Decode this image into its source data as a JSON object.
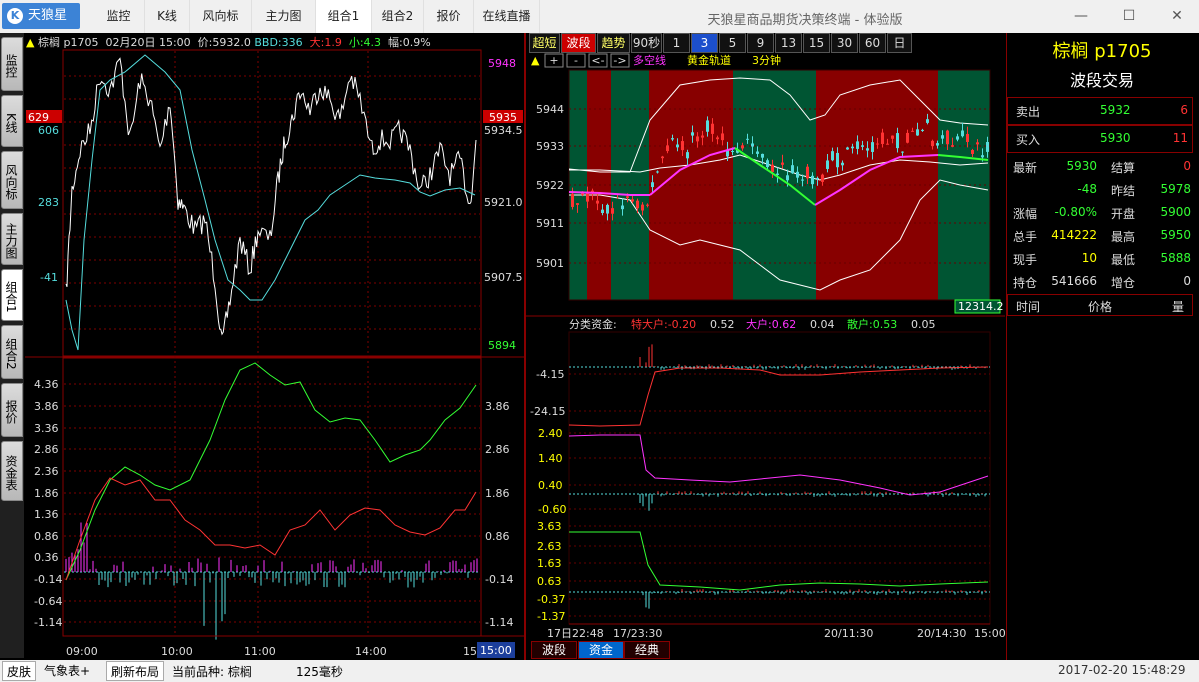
{
  "app": {
    "logo": "天狼星",
    "logo_mark": "K",
    "title": "天狼星商品期货决策终端 - 体验版"
  },
  "nav": [
    "监控",
    "K线",
    "风向标",
    "主力图",
    "组合1",
    "组合2",
    "报价",
    "在线直播"
  ],
  "nav_active": 4,
  "sidebar": [
    "监控",
    "K线",
    "风向标",
    "主力图",
    "组合1",
    "组合2",
    "报价",
    "资金表"
  ],
  "sidebar_active": 4,
  "left_panel": {
    "info": {
      "name": "棕榈",
      "code": "p1705",
      "date": "02月20日",
      "time": "15:00",
      "price": "价:5932.0",
      "bbd": "BBD:336",
      "big": "大:1.9",
      "small": "小:4.3",
      "amp": "幅:0.9%"
    },
    "price_axis_right": [
      "5948",
      "5935",
      "5934.5",
      "5921.0",
      "5907.5",
      "5894"
    ],
    "price_axis_left": [
      "629",
      "606",
      "283",
      "-41"
    ],
    "fund_axis_left": [
      "4.36",
      "3.86",
      "3.36",
      "2.86",
      "2.36",
      "1.86",
      "1.36",
      "0.86",
      "0.36",
      "-0.14",
      "-0.64",
      "-1.14"
    ],
    "fund_axis_right": [
      "3.86",
      "2.86",
      "1.86",
      "0.86",
      "-0.14",
      "-1.14"
    ],
    "time_axis": [
      "09:00",
      "10:00",
      "11:00",
      "14:00",
      "15"
    ],
    "cursor_time": "15:00"
  },
  "middle_panel": {
    "top_buttons": [
      "超短",
      "波段",
      "趋势",
      "90秒",
      "1",
      "3",
      "5",
      "9",
      "13",
      "15",
      "30",
      "60",
      "日"
    ],
    "toolbar": [
      "▲",
      "+",
      "-",
      "<-",
      "->"
    ],
    "legend": {
      "line": "多空线",
      "gold": "黄金轨道",
      "period": "3分钟"
    },
    "price_axis": [
      "5944",
      "5933",
      "5922",
      "5911",
      "5901"
    ],
    "volume_label": "12314.2",
    "fund_header": {
      "label": "分类资金:",
      "t_big": "特大户:-0.20",
      "t_big_v": "0.52",
      "big": "大户:0.62",
      "big_v": "0.04",
      "retail": "散户:0.53",
      "retail_v": "0.05"
    },
    "fund_axis1": [
      "-4.15",
      "-24.15"
    ],
    "fund_axis2": [
      "2.40",
      "1.40",
      "0.40",
      "-0.60"
    ],
    "fund_axis3": [
      "3.63",
      "2.63",
      "1.63",
      "0.63",
      "-0.37",
      "-1.37"
    ],
    "time_axis": [
      "17日22:48",
      "17/23:30",
      "20/11:30",
      "20/14:30",
      "15:00"
    ],
    "bottom_tabs": [
      "波段",
      "资金",
      "经典"
    ]
  },
  "right_panel": {
    "title": "棕榈 p1705",
    "subtitle": "波段交易",
    "sell": {
      "label": "卖出",
      "price": "5932",
      "qty": "6"
    },
    "buy": {
      "label": "买入",
      "price": "5930",
      "qty": "11"
    },
    "rows": [
      {
        "l1": "最新",
        "v1": "5930",
        "l2": "结算",
        "v2": "0"
      },
      {
        "l1": "",
        "v1": "-48",
        "l2": "昨结",
        "v2": "5978"
      },
      {
        "l1": "涨幅",
        "v1": "-0.80%",
        "l2": "开盘",
        "v2": "5900"
      },
      {
        "l1": "总手",
        "v1": "414222",
        "l2": "最高",
        "v2": "5950"
      },
      {
        "l1": "现手",
        "v1": "10",
        "l2": "最低",
        "v2": "5888"
      },
      {
        "l1": "持仓",
        "v1": "541666",
        "l2": "增仓",
        "v2": "0"
      }
    ],
    "tick_header": [
      "时间",
      "价格",
      "量"
    ]
  },
  "statusbar": {
    "skin": "皮肤",
    "weather": "气象表+",
    "refresh": "刷新布局",
    "current": "当前品种: 棕榈",
    "latency": "125毫秒",
    "datetime": "2017-02-20 15:48:29"
  },
  "colors": {
    "bg": "#000000",
    "grid": "#800000",
    "red": "#ff3333",
    "green": "#33ff33",
    "cyan": "#55dddd",
    "magenta": "#ff33ff",
    "yellow": "#ffff00",
    "gold": "#ddcc00"
  }
}
